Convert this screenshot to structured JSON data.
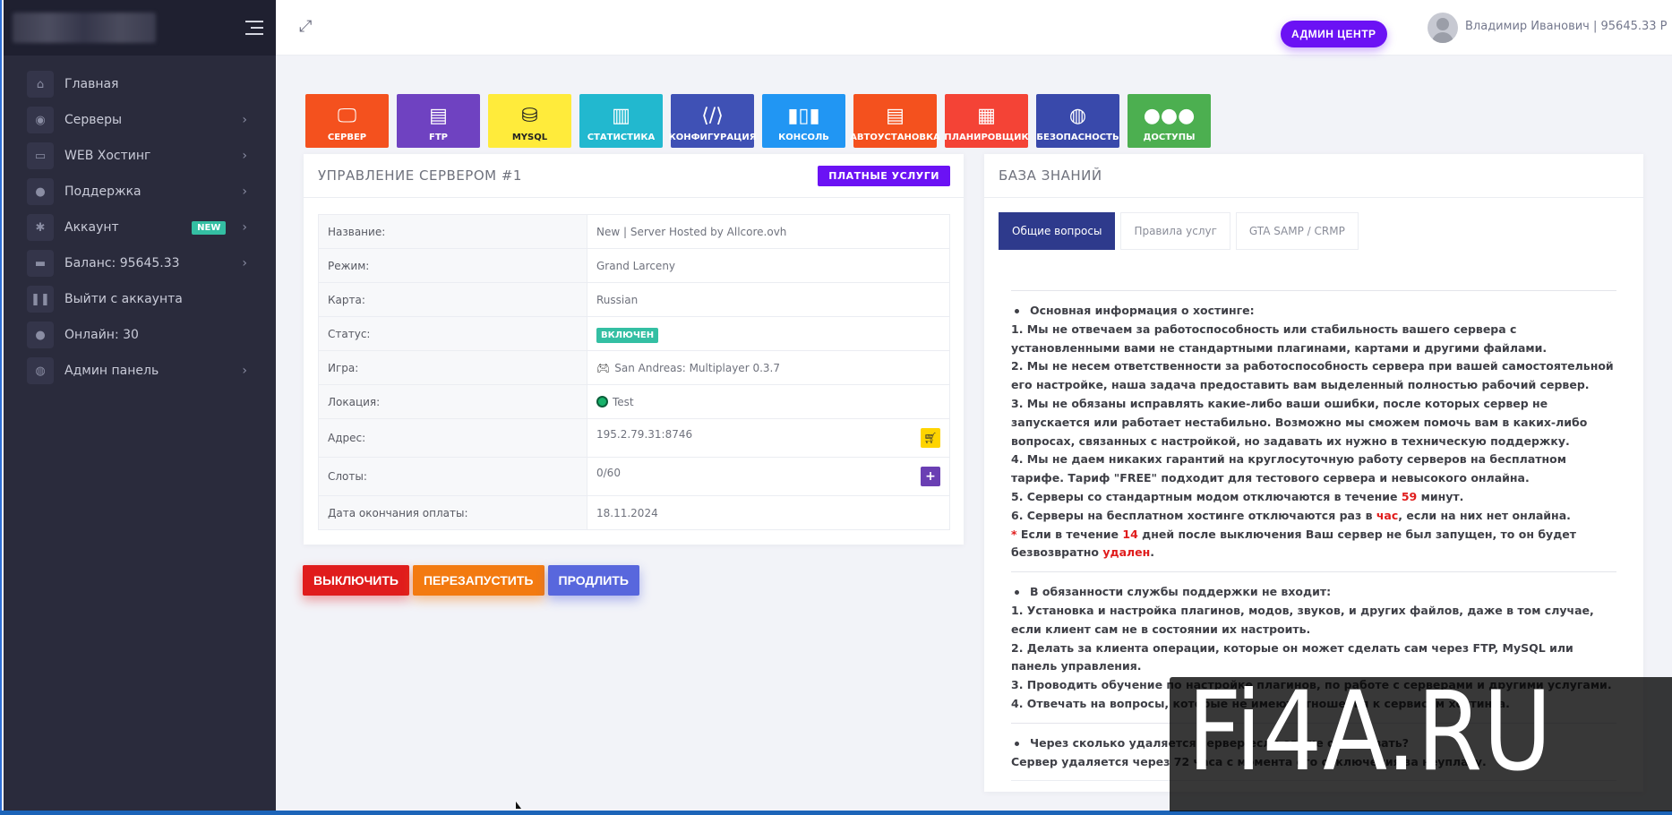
{
  "topbar": {
    "admin_center": "АДМИН ЦЕНТР",
    "user": "Владимир Иванович | 95645.33 Р"
  },
  "sidebar": {
    "items": [
      {
        "label": "Главная",
        "icon": "home-icon"
      },
      {
        "label": "Серверы",
        "icon": "gamepad-icon"
      },
      {
        "label": "WEB Хостинг",
        "icon": "hdd-icon"
      },
      {
        "label": "Поддержка",
        "icon": "users-icon"
      },
      {
        "label": "Аккаунт",
        "icon": "gear-icon",
        "badge": "NEW"
      },
      {
        "label": "Баланс: 95645.33",
        "icon": "credit-card-icon"
      },
      {
        "label": "Выйти с аккаунта",
        "icon": "pause-icon"
      },
      {
        "label": "Онлайн: 30",
        "icon": "users-icon"
      },
      {
        "label": "Админ панель",
        "icon": "globe-icon"
      }
    ]
  },
  "tiles": [
    {
      "label": "СЕРВЕР",
      "color": "#f4511e",
      "icon": "monitor-icon"
    },
    {
      "label": "FTP",
      "color": "#6f42c1",
      "icon": "file-icon"
    },
    {
      "label": "MYSQL",
      "color": "#ffeb3b",
      "icon": "database-icon"
    },
    {
      "label": "СТАТИСТИКА",
      "color": "#22b8cf",
      "icon": "bar-chart-icon"
    },
    {
      "label": "КОНФИГУРАЦИЯ",
      "color": "#3f51b5",
      "icon": "code-file-icon"
    },
    {
      "label": "КОНСОЛЬ",
      "color": "#2196f3",
      "icon": "barcode-icon"
    },
    {
      "label": "АВТОУСТАНОВКА",
      "color": "#f4511e",
      "icon": "document-icon"
    },
    {
      "label": "ПЛАНИРОВЩИК",
      "color": "#f44336",
      "icon": "calendar-icon"
    },
    {
      "label": "БЕЗОПАСНОСТЬ",
      "color": "#3949ab",
      "icon": "globe-icon"
    },
    {
      "label": "ДОСТУПЫ",
      "color": "#4caf50",
      "icon": "users-icon"
    }
  ],
  "server": {
    "title": "УПРАВЛЕНИЕ СЕРВЕРОМ #1",
    "paid_services": "ПЛАТНЫЕ УСЛУГИ",
    "rows": {
      "name": {
        "k": "Название:",
        "v": "New | Server Hosted by Allcore.ovh"
      },
      "mode": {
        "k": "Режим:",
        "v": "Grand Larceny"
      },
      "map": {
        "k": "Карта:",
        "v": "Russian"
      },
      "status": {
        "k": "Статус:",
        "v": "ВКЛЮЧЕН"
      },
      "game": {
        "k": "Игра:",
        "v": "San Andreas: Multiplayer 0.3.7"
      },
      "location": {
        "k": "Локация:",
        "v": "Test"
      },
      "address": {
        "k": "Адрес:",
        "v": "195.2.79.31:8746"
      },
      "slots": {
        "k": "Слоты:",
        "v": "0/60"
      },
      "paid_until": {
        "k": "Дата окончания оплаты:",
        "v": "18.11.2024"
      }
    },
    "actions": {
      "off": "ВЫКЛЮЧИТЬ",
      "restart": "ПЕРЕЗАПУСТИТЬ",
      "extend": "ПРОДЛИТЬ"
    }
  },
  "kb": {
    "title": "БАЗА ЗНАНИЙ",
    "tabs": [
      "Общие вопросы",
      "Правила услуг",
      "GTA SAMP / CRMP"
    ],
    "s1": {
      "head": "Основная информация о хостинге:",
      "l1": "1. Мы не отвечаем за работоспособность или стабильность вашего сервера с установленными вами не стандартными плагинами, картами и другими файлами.",
      "l2": "2. Мы не несем ответственности за работоспособность сервера при вашей самостоятельной его настройке, наша задача предоставить вам выделенный полностью рабочий сервер.",
      "l3": "3. Мы не обязаны исправлять какие-либо ваши ошибки, после которых сервер не запускается или работает нестабильно. Возможно мы сможем помочь вам в каких-либо вопросах, связанных с настройкой, но задавать их нужно в техническую поддержку.",
      "l4": "4. Мы не даем никаких гарантий на круглосуточную работу серверов на бесплатном тарифе. Тариф \"FREE\" подходит для тестового сервера и невысокого онлайна.",
      "l5a": "5. Серверы со стандартным модом отключаются в течение ",
      "l5n": "59",
      "l5b": " минут.",
      "l6a": "6. Серверы на бесплатном хостинге отключаются раз в ",
      "l6n": "час",
      "l6b": ", если на них нет онлайна.",
      "l7s": "*",
      "l7a": " Если в течение ",
      "l7n": "14",
      "l7b": " дней после выключения Ваш сервер не был запущен, то он будет безвозвратно ",
      "l7c": "удален",
      "l7d": "."
    },
    "s2": {
      "head": "В обязанности службы поддержки не входит:",
      "l1": "1. Установка и настройка плагинов, модов, звуков, и других файлов, даже в том случае, если клиент сам не в состоянии их настроить.",
      "l2": "2. Делать за клиента операции, которые он может сделать сам через FTP, MySQL или панель управления.",
      "l3": "3. Проводить обучение по настройке плагинов, по работе с серверами и другими услугами.",
      "l4": "4. Отвечать на вопросы, которые не имеют отношения к сервисам хостинга."
    },
    "s3": {
      "head": "Через сколько удаляется сервер если его не оплачивать?",
      "l1": "Сервер удаляется через 72 часа с момента его отключения за неуплату."
    }
  },
  "watermark": "Fi4A.RU"
}
